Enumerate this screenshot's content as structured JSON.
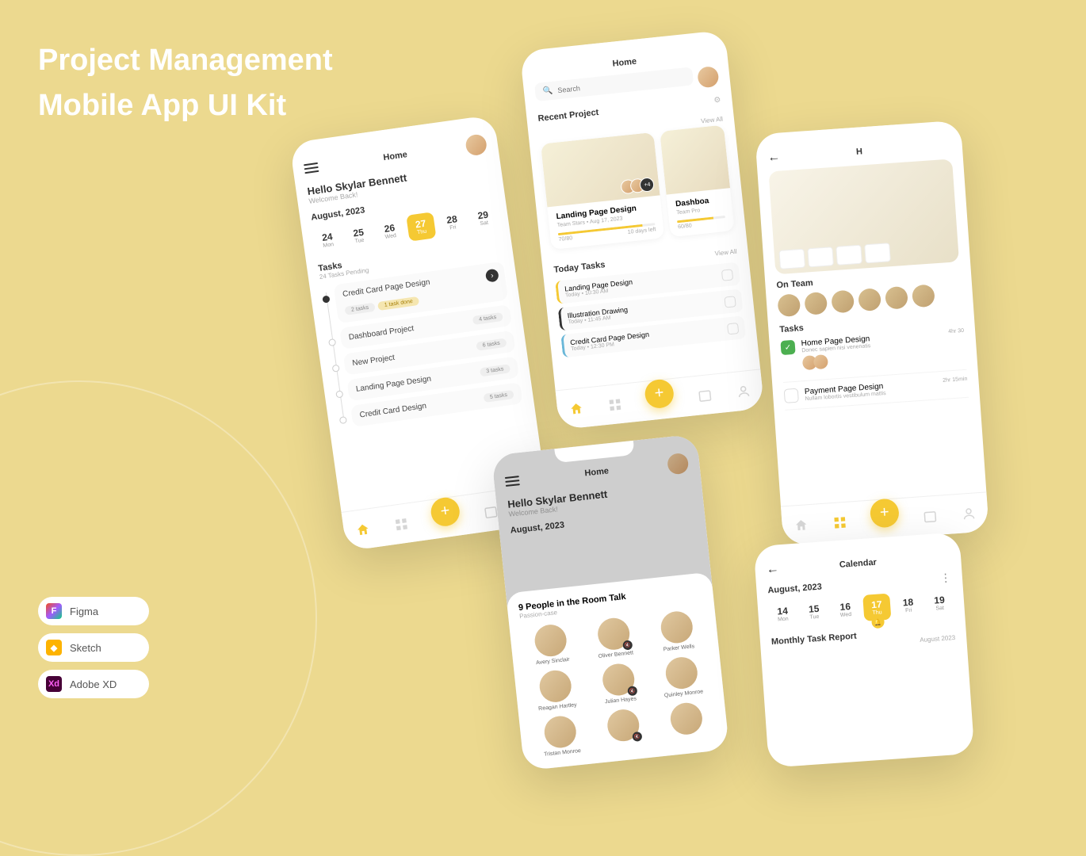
{
  "title_line1": "Project Management",
  "title_line2": "Mobile App UI Kit",
  "tools": {
    "figma": "Figma",
    "sketch": "Sketch",
    "xd": "Adobe XD"
  },
  "common": {
    "home": "Home",
    "calendar_title": "Calendar",
    "view_all": "View All",
    "search_placeholder": "Search",
    "back": "←"
  },
  "greeting": {
    "hello": "Hello Skylar Bennett",
    "welcome": "Welcome Back!",
    "month": "August, 2023"
  },
  "dates1": [
    {
      "num": "24",
      "day": "Mon"
    },
    {
      "num": "25",
      "day": "Tue"
    },
    {
      "num": "26",
      "day": "Wed"
    },
    {
      "num": "27",
      "day": "Thu"
    },
    {
      "num": "28",
      "day": "Fri"
    },
    {
      "num": "29",
      "day": "Sat"
    }
  ],
  "dates2": [
    {
      "num": "14",
      "day": "Mon"
    },
    {
      "num": "15",
      "day": "Tue"
    },
    {
      "num": "16",
      "day": "Wed"
    },
    {
      "num": "17",
      "day": "Thu"
    },
    {
      "num": "18",
      "day": "Fri"
    },
    {
      "num": "19",
      "day": "Sat"
    }
  ],
  "tasks_section": {
    "title": "Tasks",
    "sub": "24 Tasks Pending"
  },
  "timeline_tasks": [
    {
      "name": "Credit Card Page Design",
      "p1": "2 tasks",
      "p2": "1 task done"
    },
    {
      "name": "Dashboard Project",
      "count": "4 tasks"
    },
    {
      "name": "New Project",
      "count": "6 tasks"
    },
    {
      "name": "Landing Page Design",
      "count": "3 tasks"
    },
    {
      "name": "Credit Card Design",
      "count": "5 tasks"
    }
  ],
  "recent": {
    "title": "Recent Project",
    "card1": {
      "name": "Landing Page Design",
      "team": "Team Stars",
      "due": "Aug 17, 2023",
      "prog": "70/80",
      "left": "10 days left",
      "fill": 87
    },
    "card2": {
      "name": "Dashboa",
      "team": "Team Pro",
      "prog": "60/80"
    }
  },
  "today": {
    "title": "Today Tasks",
    "items": [
      {
        "name": "Landing Page Design",
        "time": "Today • 10:30 AM",
        "color": "#f5c933"
      },
      {
        "name": "Illustration Drawing",
        "time": "Today • 11:45 AM",
        "color": "#333"
      },
      {
        "name": "Credit Card Page Design",
        "time": "Today • 12:30 PM",
        "color": "#6ab7d8"
      }
    ]
  },
  "detail": {
    "on_team": "On Team",
    "tasks_title": "Tasks",
    "t1": {
      "name": "Home Page Design",
      "desc": "Donec sapien nisi venenatis",
      "time": "4hr 30"
    },
    "t2": {
      "name": "Payment Page Design",
      "desc": "Nullam lobortis vestibulum mattis",
      "time": "2hr 15min"
    }
  },
  "sheet": {
    "title": "9 People in the Room Talk",
    "sub": "Passion-case",
    "people": [
      "Avery Sinclair",
      "Oliver Bennett",
      "Parker Wells",
      "Reagan Hartley",
      "Julian Hayes",
      "Quinley Monroe",
      "Tristan Monroe",
      "",
      ""
    ]
  },
  "calendar2": {
    "month": "August, 2023",
    "report": "Monthly Task Report",
    "report_sub": "August 2023"
  }
}
